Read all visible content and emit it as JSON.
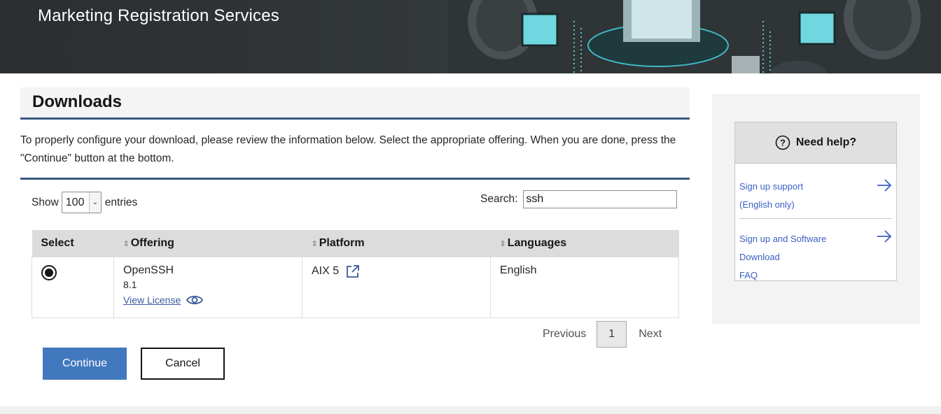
{
  "banner": {
    "title": "Marketing Registration Services"
  },
  "downloads": {
    "title": "Downloads",
    "intro": "To properly configure your download, please review the information below. Select the appropriate offering. When you are done, press the \"Continue\" button at the bottom."
  },
  "controls": {
    "show_label": "Show",
    "entries_value": "100",
    "entries_label": "entries",
    "search_label": "Search:",
    "search_value": "ssh"
  },
  "table": {
    "headers": [
      "Select",
      "Offering",
      "Platform",
      "Languages"
    ],
    "rows": [
      {
        "selected": true,
        "offering": "OpenSSH",
        "version": "8.1",
        "license_link": "View License",
        "platform": "AIX 5",
        "languages": "English"
      }
    ]
  },
  "pagination": {
    "previous": "Previous",
    "page": "1",
    "next": "Next"
  },
  "buttons": {
    "continue": "Continue",
    "cancel": "Cancel"
  },
  "help": {
    "title": "Need help?",
    "links": [
      {
        "line1": "Sign up support",
        "line2": "(English only)"
      },
      {
        "line1": "Sign up and Software Download",
        "line2": "FAQ"
      }
    ]
  },
  "colors": {
    "accent": "#4178be",
    "rule": "#3a5a80",
    "link": "#3b5fc4"
  }
}
